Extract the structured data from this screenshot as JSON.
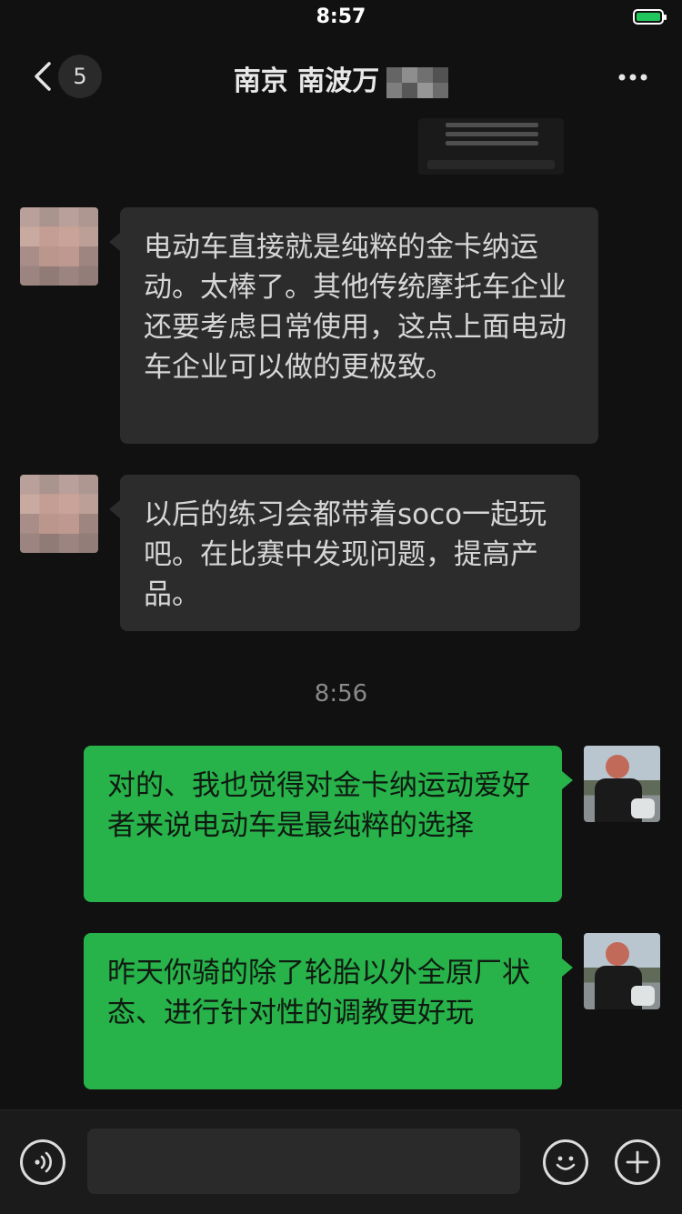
{
  "status_bar": {
    "time": "8:57"
  },
  "header": {
    "unread_count": "5",
    "title": "南京 南波万"
  },
  "messages": [
    {
      "side": "left",
      "text": "电动车直接就是纯粹的金卡纳运动。太棒了。其他传统摩托车企业还要考虑日常使用，这点上面电动车企业可以做的更极致。"
    },
    {
      "side": "left",
      "text": "以后的练习会都带着soco一起玩吧。在比赛中发现问题，提高产品。"
    },
    {
      "side": "right",
      "text": "对的、我也觉得对金卡纳运动爱好者来说电动车是最纯粹的选择"
    },
    {
      "side": "right",
      "text": "昨天你骑的除了轮胎以外全原厂状态、进行针对性的调教更好玩"
    }
  ],
  "timestamp": "8:56",
  "input": {
    "value": "",
    "placeholder": ""
  },
  "colors": {
    "background": "#111111",
    "incoming_bubble": "#2c2c2c",
    "outgoing_bubble": "#27b24a",
    "battery": "#21c55d"
  },
  "icons": {
    "back": "chevron-left-icon",
    "more": "more-dots-icon",
    "voice": "voice-icon",
    "emoji": "emoji-icon",
    "plus": "plus-icon"
  }
}
